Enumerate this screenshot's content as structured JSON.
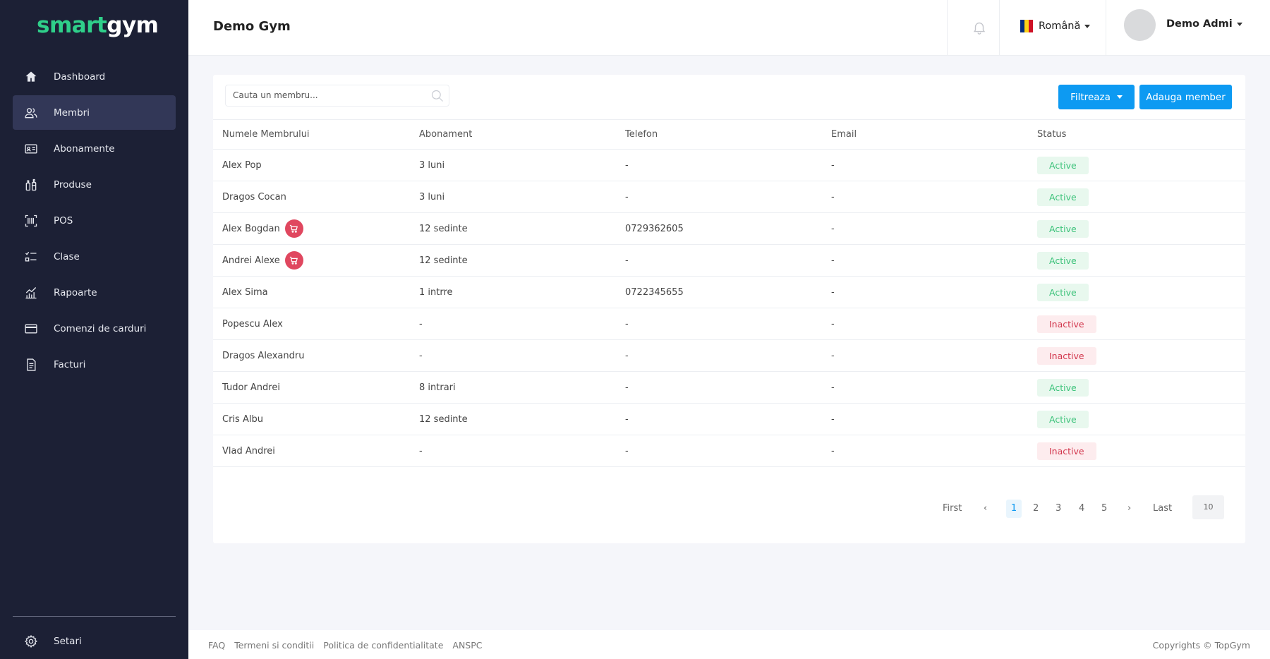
{
  "brand": {
    "part1": "smart",
    "part2": "gym"
  },
  "sidebar": {
    "items": [
      {
        "label": "Dashboard",
        "icon": "home-icon"
      },
      {
        "label": "Membri",
        "icon": "users-icon"
      },
      {
        "label": "Abonamente",
        "icon": "id-card-icon"
      },
      {
        "label": "Produse",
        "icon": "bottles-icon"
      },
      {
        "label": "POS",
        "icon": "barcode-icon"
      },
      {
        "label": "Clase",
        "icon": "checklist-icon"
      },
      {
        "label": "Rapoarte",
        "icon": "chart-icon"
      },
      {
        "label": "Comenzi de carduri",
        "icon": "credit-card-icon"
      },
      {
        "label": "Facturi",
        "icon": "invoice-icon"
      }
    ],
    "active_index": 1,
    "settings_label": "Setari"
  },
  "header": {
    "title": "Demo Gym",
    "language": "Română",
    "user_name": "Demo Admi"
  },
  "members": {
    "search_placeholder": "Cauta un membru...",
    "filter_label": "Filtreaza",
    "add_label": "Adauga member",
    "columns": [
      "Numele Membrului",
      "Abonament",
      "Telefon",
      "Email",
      "Status"
    ],
    "rows": [
      {
        "name": "Alex Pop",
        "cart": false,
        "subscription": "3 luni",
        "phone": "-",
        "email": "-",
        "status": "Active"
      },
      {
        "name": "Dragos Cocan",
        "cart": false,
        "subscription": "3 luni",
        "phone": "-",
        "email": "-",
        "status": "Active"
      },
      {
        "name": "Alex Bogdan",
        "cart": true,
        "subscription": "12 sedinte",
        "phone": "0729362605",
        "email": "-",
        "status": "Active"
      },
      {
        "name": "Andrei Alexe",
        "cart": true,
        "subscription": "12 sedinte",
        "phone": "-",
        "email": "-",
        "status": "Active"
      },
      {
        "name": "Alex Sima",
        "cart": false,
        "subscription": "1 intrre",
        "phone": "0722345655",
        "email": "-",
        "status": "Active"
      },
      {
        "name": "Popescu Alex",
        "cart": false,
        "subscription": "-",
        "phone": "-",
        "email": "-",
        "status": "Inactive"
      },
      {
        "name": "Dragos Alexandru",
        "cart": false,
        "subscription": "-",
        "phone": "-",
        "email": "-",
        "status": "Inactive"
      },
      {
        "name": "Tudor Andrei",
        "cart": false,
        "subscription": "8 intrari",
        "phone": "-",
        "email": "-",
        "status": "Active"
      },
      {
        "name": "Cris Albu",
        "cart": false,
        "subscription": "12 sedinte",
        "phone": "-",
        "email": "-",
        "status": "Active"
      },
      {
        "name": "Vlad Andrei",
        "cart": false,
        "subscription": "-",
        "phone": "-",
        "email": "-",
        "status": "Inactive"
      }
    ]
  },
  "pagination": {
    "first": "First",
    "last": "Last",
    "prev": "‹",
    "next": "›",
    "pages": [
      "1",
      "2",
      "3",
      "4",
      "5"
    ],
    "current": "1",
    "per_page": "10"
  },
  "footer": {
    "links": [
      "FAQ",
      "Termeni si conditii",
      "Politica de confidentialitate",
      "ANSPC"
    ],
    "copyright": "Copyrights © TopGym"
  },
  "colors": {
    "sidebar_bg": "#1c2035",
    "sidebar_active": "#323757",
    "brand_green": "#2fcf8a",
    "primary": "#0d9af2",
    "active_badge_text": "#3cc27a",
    "inactive_badge_text": "#d2374d",
    "cart_badge": "#e0475f"
  }
}
